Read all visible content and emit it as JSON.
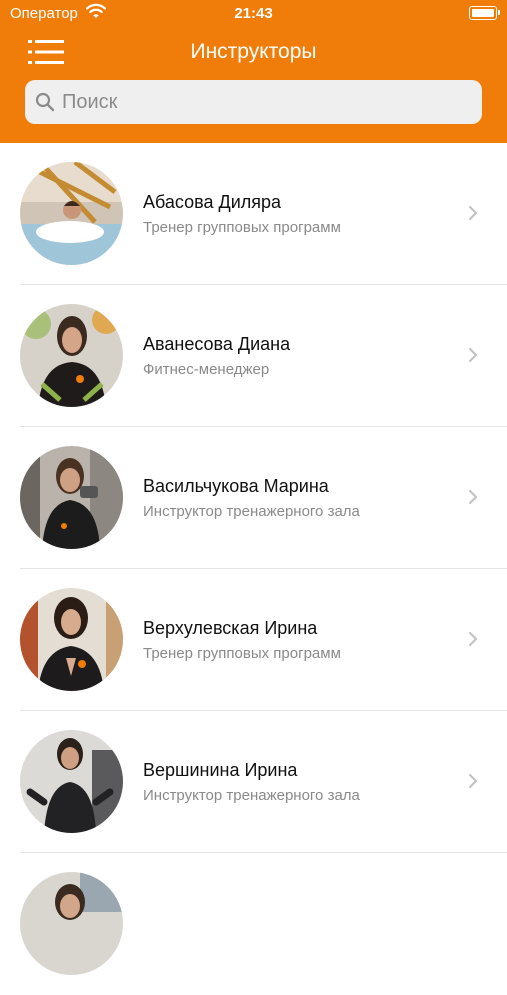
{
  "status_bar": {
    "carrier": "Оператор",
    "time": "21:43"
  },
  "header": {
    "title": "Инструкторы"
  },
  "search": {
    "placeholder": "Поиск"
  },
  "instructors": [
    {
      "name": "Абасова Диляра",
      "role": "Тренер групповых программ"
    },
    {
      "name": "Аванесова Диана",
      "role": "Фитнес-менеджер"
    },
    {
      "name": "Васильчукова Марина",
      "role": "Инструктор тренажерного зала"
    },
    {
      "name": "Верхулевская Ирина",
      "role": "Тренер групповых программ"
    },
    {
      "name": "Вершинина Ирина",
      "role": "Инструктор тренажерного зала"
    }
  ],
  "colors": {
    "accent": "#f07d0a"
  }
}
